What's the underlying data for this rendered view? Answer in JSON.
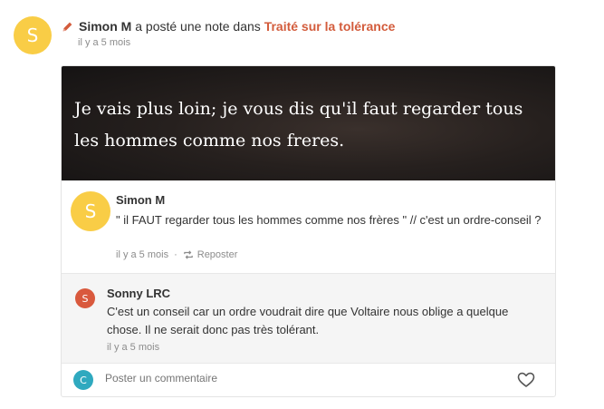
{
  "activity": {
    "avatar_letter": "S",
    "user": "Simon M",
    "action": "a posté une note dans",
    "book": "Traité sur la tolérance",
    "time": "il y a 5 mois"
  },
  "quote": {
    "text": "Je vais plus loin; je vous dis qu'il faut regarder tous les hommes comme nos freres."
  },
  "note": {
    "avatar_letter": "S",
    "author": "Simon M",
    "text": "\" il FAUT regarder tous les hommes comme nos frères \" // c'est un ordre-conseil ?",
    "time": "il y a 5 mois",
    "separator": "·",
    "repost_label": "Reposter"
  },
  "comment": {
    "avatar_letter": "S",
    "author": "Sonny LRC",
    "text": "C'est un conseil car un ordre voudrait dire que Voltaire nous oblige a quelque chose. Il ne serait donc pas très tolérant.",
    "time": "il y a 5 mois"
  },
  "reply": {
    "avatar_letter": "C",
    "placeholder": "Poster un commentaire"
  },
  "colors": {
    "accent": "#d35c3c",
    "avatar_yellow": "#f9cd46",
    "avatar_red": "#d9593d",
    "avatar_teal": "#2fa9bf"
  },
  "icons": [
    "pencil-icon",
    "repost-icon",
    "heart-icon"
  ]
}
